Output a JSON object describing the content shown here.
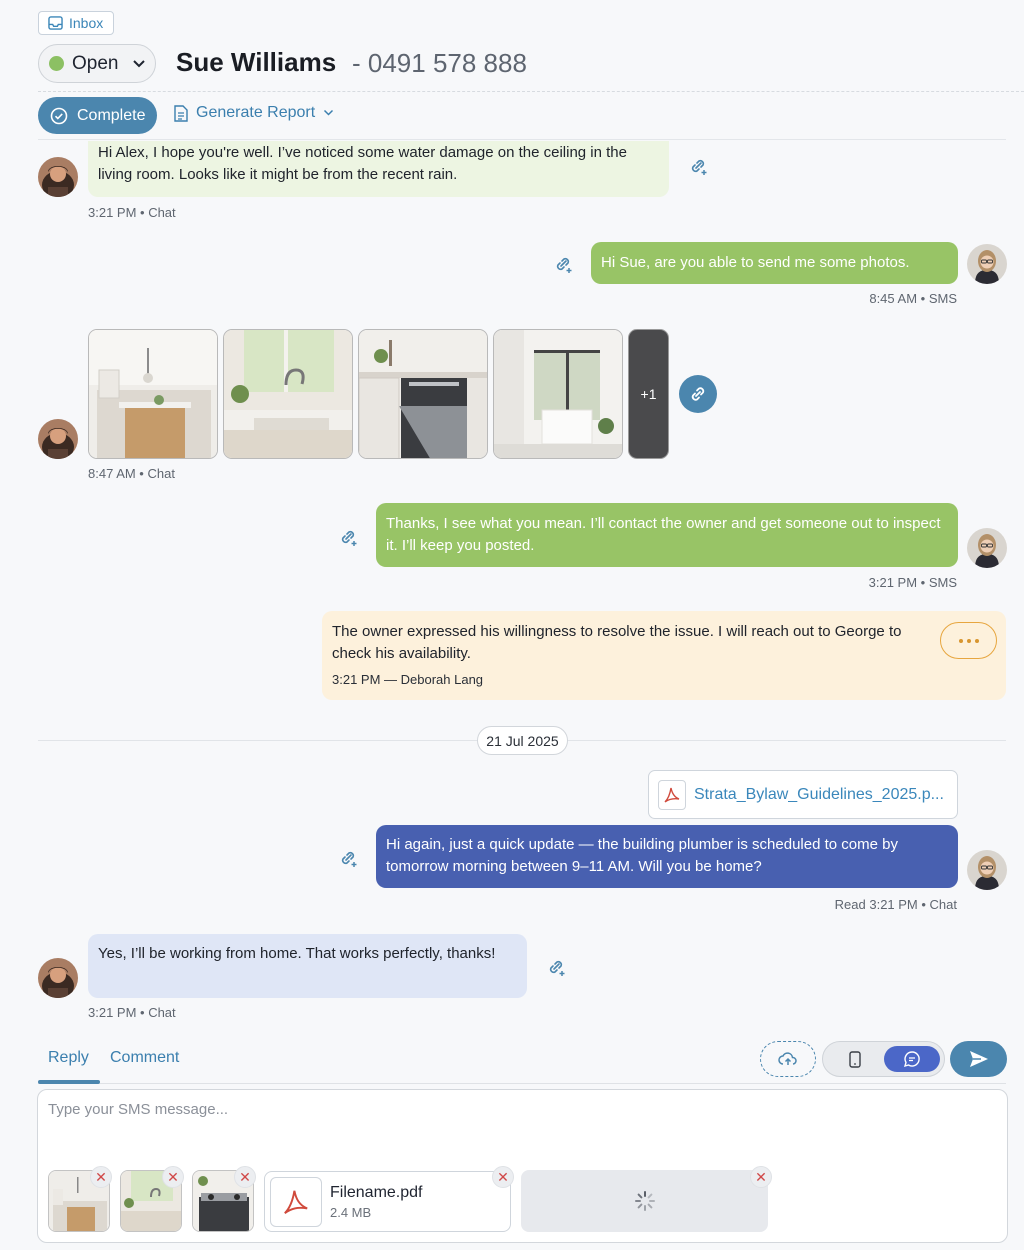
{
  "header": {
    "inbox_label": "Inbox",
    "status": "Open",
    "status_color": "#8cc063",
    "contact_name": "Sue Williams",
    "contact_phone": "- 0491 578 888",
    "complete_label": "Complete",
    "report_label": "Generate Report"
  },
  "messages": {
    "m1": {
      "text": "Hi Alex, I hope you're well. I’ve noticed some water damage on the ceiling in the living room. Looks like it might be from the recent rain.",
      "meta": "3:21 PM • Chat"
    },
    "m2": {
      "text": "Hi Sue, are you able to send me some photos.",
      "meta": "8:45 AM • SMS"
    },
    "m3": {
      "more_count": "+1",
      "meta": "8:47 AM • Chat"
    },
    "m4": {
      "text": "Thanks, I see what you mean. I’ll contact the owner and get someone out to inspect it. I’ll keep you posted.",
      "meta": "3:21 PM • SMS"
    },
    "m5": {
      "text": "The owner expressed his willingness to resolve the issue. I will reach out to George to check his availability.",
      "meta": "3:21 PM — Deborah Lang"
    },
    "date_divider": "21 Jul 2025",
    "m6": {
      "attachment": "Strata_Bylaw_Guidelines_2025.p...",
      "text": "Hi again, just a quick update — the building plumber is scheduled to come by tomorrow morning between 9–11 AM. Will you be home?",
      "meta": "Read 3:21 PM • Chat"
    },
    "m7": {
      "text": "Yes, I’ll be working from home. That works perfectly, thanks!",
      "meta": "3:21 PM • Chat"
    }
  },
  "composer": {
    "tabs": [
      "Reply",
      "Comment"
    ],
    "placeholder": "Type your SMS message...",
    "file_name": "Filename.pdf",
    "file_size": "2.4 MB",
    "remove_glyph": "✕"
  },
  "colors": {
    "accent": "#4b86ae",
    "green": "#98c466",
    "blue": "#4860b0"
  }
}
